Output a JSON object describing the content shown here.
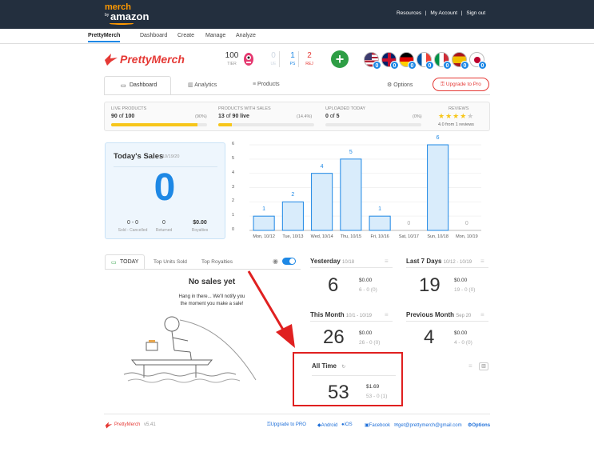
{
  "topbar": {
    "logo_top": "merch",
    "logo_by": "by",
    "logo_bottom": "amazon",
    "links": [
      "Resources",
      "|",
      "My Account",
      "|",
      "Sign out"
    ]
  },
  "subnav": [
    "PrettyMerch",
    "Dashboard",
    "Create",
    "Manage",
    "Analyze"
  ],
  "brand": {
    "name": "PrettyMerch"
  },
  "tier": {
    "value": "100",
    "label": "TIER"
  },
  "counters": [
    {
      "value": "0",
      "label": "UE",
      "color": "#cfd8e3"
    },
    {
      "value": "1",
      "label": "PS",
      "color": "#1e88e5"
    },
    {
      "value": "2",
      "label": "REJ",
      "color": "#e53935"
    }
  ],
  "flags": [
    {
      "name": "us-flag",
      "badge": "0"
    },
    {
      "name": "uk-flag",
      "badge": "0"
    },
    {
      "name": "de-flag",
      "badge": "0"
    },
    {
      "name": "fr-flag",
      "badge": "0"
    },
    {
      "name": "it-flag",
      "badge": "0"
    },
    {
      "name": "es-flag",
      "badge": "0"
    },
    {
      "name": "jp-flag",
      "badge": "0"
    }
  ],
  "tabs": {
    "dashboard": "Dashboard",
    "analytics": "Analytics",
    "products": "Products",
    "options": "Options",
    "upgrade": "Upgrade to Pro"
  },
  "stats": {
    "live": {
      "label": "LIVE PRODUCTS",
      "value": "90",
      "of": "of",
      "total": "100",
      "pct": "(90%)",
      "fill": 0.9
    },
    "sales": {
      "label": "PRODUCTS WITH SALES",
      "value": "13",
      "of": "of",
      "total": "90 live",
      "pct": "(14.4%)",
      "fill": 0.144
    },
    "uploaded": {
      "label": "UPLOADED TODAY",
      "value": "0",
      "of": "of",
      "total": "5",
      "pct": "(0%)",
      "fill": 0
    },
    "reviews": {
      "label": "REVIEWS",
      "rating": 4.0,
      "text": "4.0 from 1 reviews"
    }
  },
  "today": {
    "title": "Today's Sales",
    "date": "10/19/20",
    "big": "0",
    "sold": "0 - 0",
    "sold_label": "Sold - Cancelled",
    "returned": "0",
    "returned_label": "Returned",
    "royalties": "$0.00",
    "royalties_label": "Royalties"
  },
  "chart_data": {
    "type": "bar",
    "categories": [
      "Mon, 10/12",
      "Tue, 10/13",
      "Wed, 10/14",
      "Thu, 10/15",
      "Fri, 10/16",
      "Sat, 10/17",
      "Sun, 10/18",
      "Mon, 10/19"
    ],
    "values": [
      1,
      2,
      4,
      5,
      1,
      0,
      6,
      0
    ],
    "ylim": [
      0,
      6
    ],
    "yticks": [
      "0",
      "1",
      "2",
      "3",
      "4",
      "5",
      "6"
    ],
    "bar_color": "#d9ecfb",
    "bar_border": "#1e88e5"
  },
  "salestabs": {
    "today": "TODAY",
    "units": "Top Units Sold",
    "royalties": "Top Royalties"
  },
  "nosales": {
    "title": "No sales yet",
    "line1": "Hang in there... We'll notify you",
    "line2": "the moment you make a sale!"
  },
  "periods": {
    "yesterday": {
      "title": "Yesterday",
      "sub": "10/18",
      "big": "6",
      "royalty": "$0.00",
      "detail": "6 - 0 (0)"
    },
    "last7": {
      "title": "Last 7 Days",
      "sub": "10/12 - 10/19",
      "big": "19",
      "royalty": "$0.00",
      "detail": "19 - 0 (0)"
    },
    "month": {
      "title": "This Month",
      "sub": "10/1 - 10/19",
      "big": "26",
      "royalty": "$0.00",
      "detail": "26 - 0 (0)"
    },
    "prevmonth": {
      "title": "Previous Month",
      "sub": "Sep 20",
      "big": "4",
      "royalty": "$0.00",
      "detail": "4 - 0 (0)"
    },
    "alltime": {
      "title": "All Time",
      "big": "53",
      "royalty": "$1.69",
      "detail": "53 - 0 (1)"
    }
  },
  "footer": {
    "brand": "PrettyMerch",
    "version": "v5.41",
    "upgrade": "Upgrade to PRO",
    "android": "Android",
    "ios": "iOS",
    "facebook": "Facebook",
    "email": "get@prettymerch@gmail.com",
    "options": "Options"
  },
  "colors": {
    "accent": "#1e88e5",
    "highlight": "#e02020",
    "brand_red": "#e53935",
    "green": "#2e9e45",
    "topbar": "#232f3e",
    "amazon_orange": "#f90"
  }
}
